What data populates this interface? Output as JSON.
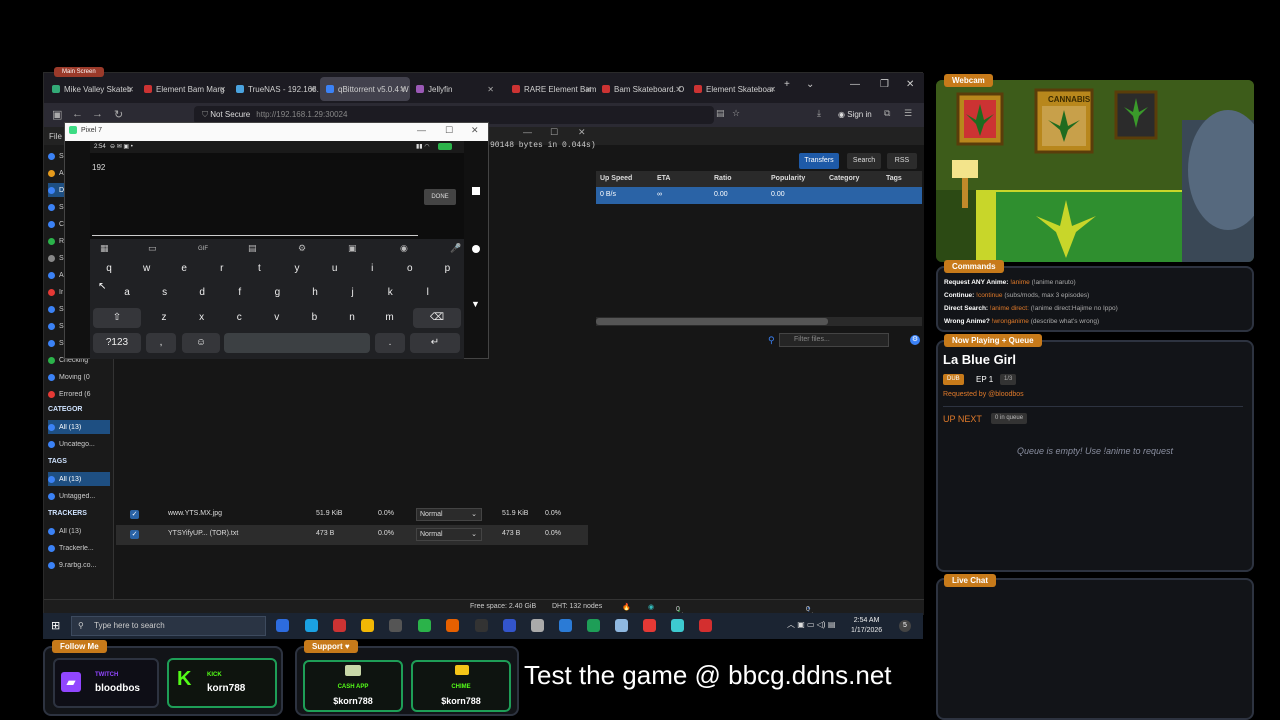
{
  "browser": {
    "vertical_tab_label": "Main Screen",
    "tabs": [
      {
        "label": "Mike Valley Skateb",
        "active": false
      },
      {
        "label": "Element Bam Marg",
        "active": false
      },
      {
        "label": "TrueNAS - 192.168.",
        "active": false
      },
      {
        "label": "qBittorrent v5.0.4 W",
        "active": true
      },
      {
        "label": "Jellyfin",
        "active": false
      },
      {
        "label": "RARE Element Bam",
        "active": false
      },
      {
        "label": "Bam Skateboard. O",
        "active": false
      },
      {
        "label": "Element Skateboar",
        "active": false
      }
    ],
    "security_label": "Not Secure",
    "url": "http://192.168.1.29:30024",
    "sign_in": "Sign in"
  },
  "qbt": {
    "menu_file": "File",
    "log_snippet": "90148 bytes in 0.044s)",
    "buttons": {
      "transfers": "Transfers",
      "search": "Search",
      "rss": "RSS"
    },
    "columns": [
      "Up Speed",
      "ETA",
      "Ratio",
      "Popularity",
      "Category",
      "Tags"
    ],
    "row": [
      "0 B/s",
      "∞",
      "0.00",
      "0.00",
      "",
      ""
    ],
    "sidebar": {
      "status_items": [
        {
          "label": "S",
          "color": "#3b82f6"
        },
        {
          "label": "A",
          "color": "#e59a1c"
        },
        {
          "label": "D",
          "color": "#3b82f6",
          "selected": true
        },
        {
          "label": "S",
          "color": "#3b82f6"
        },
        {
          "label": "C",
          "color": "#3b82f6"
        },
        {
          "label": "R",
          "color": "#2bb34a"
        },
        {
          "label": "S",
          "color": "#888888"
        },
        {
          "label": "A",
          "color": "#3b82f6"
        },
        {
          "label": "Ir",
          "color": "#e53935"
        },
        {
          "label": "S",
          "color": "#3b82f6"
        },
        {
          "label": "S",
          "color": "#3b82f6"
        },
        {
          "label": "Stalled D",
          "color": "#3b82f6"
        },
        {
          "label": "Checking",
          "color": "#2bb34a"
        },
        {
          "label": "Moving (0",
          "color": "#3b82f6"
        },
        {
          "label": "Errored (6",
          "color": "#e53935"
        }
      ],
      "categories_head": "CATEGOR",
      "categories": [
        {
          "label": "All (13)",
          "selected": true
        },
        {
          "label": "Uncatego..."
        }
      ],
      "tags_head": "TAGS",
      "tags": [
        {
          "label": "All (13)",
          "selected": true
        },
        {
          "label": "Untagged..."
        }
      ],
      "trackers_head": "TRACKERS",
      "trackers": [
        {
          "label": "All (13)"
        },
        {
          "label": "Trackerle..."
        },
        {
          "label": "9.rarbg.co..."
        }
      ]
    },
    "filter_placeholder": "Filter files...",
    "files": [
      {
        "name": "www.YTS.MX.jpg",
        "size": "51.9 KiB",
        "progress": "0.0%",
        "priority": "Normal",
        "remaining": "51.9 KiB",
        "availability": "0.0%"
      },
      {
        "name": "YTSYifyUP... (TOR).txt",
        "size": "473 B",
        "progress": "0.0%",
        "priority": "Normal",
        "remaining": "473 B",
        "availability": "0.0%"
      }
    ],
    "status": {
      "free_space": "Free space: 2.40 GiB",
      "dht": "DHT: 132 nodes",
      "dl": "0 B/s (0 B)",
      "ul": "0 B/s (0 B)"
    }
  },
  "emulator": {
    "title": "Pixel 7",
    "clock": "2:54",
    "typed_text": "192",
    "done_label": "DONE",
    "gif_label": "GIF",
    "row1": [
      "q",
      "w",
      "e",
      "r",
      "t",
      "y",
      "u",
      "i",
      "o",
      "p"
    ],
    "row1_hints": [
      "1",
      "2",
      "3",
      "4",
      "5",
      "6",
      "7",
      "8",
      "9",
      "0"
    ],
    "row2": [
      "a",
      "s",
      "d",
      "f",
      "g",
      "h",
      "j",
      "k",
      "l"
    ],
    "row3": [
      "z",
      "x",
      "c",
      "v",
      "b",
      "n",
      "m"
    ],
    "sym_label": "?123",
    "comma": ",",
    "period": "."
  },
  "taskbar": {
    "search_placeholder": "Type here to search",
    "time": "2:54 AM",
    "date": "1/17/2026",
    "notif_count": "5"
  },
  "overlay": {
    "webcam_tag": "Webcam",
    "webcam_sign": "CANNABIS",
    "commands_tag": "Commands",
    "commands": [
      {
        "label": "Request ANY Anime:",
        "cmd": "!anime",
        "desc": "(!anime naruto)"
      },
      {
        "label": "Continue:",
        "cmd": "!continue",
        "desc": "(subs/mods, max 3 episodes)"
      },
      {
        "label": "Direct Search:",
        "cmd": "!anime direct:",
        "desc": "(!anime direct:Hajime no Ippo)"
      },
      {
        "label": "Wrong Anime?",
        "cmd": "!wronganime",
        "desc": "(describe what's wrong)"
      }
    ],
    "nowplaying_tag": "Now Playing + Queue",
    "show_title": "La Blue Girl",
    "dub_badge": "DUB",
    "episode": "EP 1",
    "ep_count": "1/3",
    "requested_by": "Requested by @bloodbos",
    "up_next": "UP NEXT",
    "queue_count": "0 in queue",
    "queue_empty": "Queue is empty! Use !anime to request",
    "chat_tag": "Live Chat",
    "follow_tag": "Follow Me",
    "twitch_label": "TWITCH",
    "twitch_user": "bloodbos",
    "kick_label": "KICK",
    "kick_user": "korn788",
    "support_tag": "Support",
    "cashapp_label": "CASH APP",
    "cashapp_user": "$korn788",
    "chime_label": "CHIME",
    "chime_user": "$korn788",
    "promo": "Test the game @ bbcg.ddns.net"
  },
  "colors": {
    "accent_orange": "#c77a1a",
    "green_border": "#1e9e57",
    "qbt_blue": "#2a63a6"
  }
}
